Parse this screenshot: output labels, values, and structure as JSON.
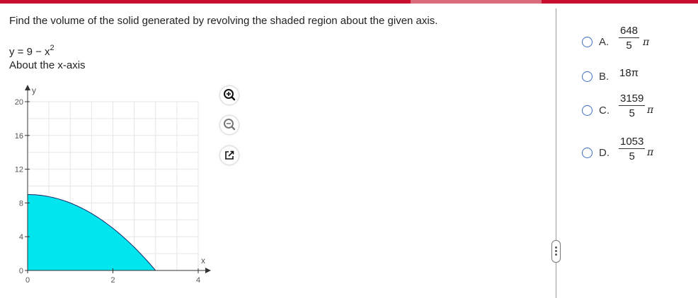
{
  "header": {
    "accent": "#c8102e"
  },
  "question": {
    "prompt": "Find the volume of the solid generated by revolving the shaded region about the given axis.",
    "equation_base": "y = 9 − x",
    "equation_exp": "2",
    "axis": "About the x-axis"
  },
  "graph": {
    "x_label": "x",
    "y_label": "y",
    "x_ticks": [
      "0",
      "2",
      "4"
    ],
    "y_ticks": [
      "0",
      "4",
      "8",
      "12",
      "16",
      "20"
    ],
    "fill_color": "#00e5ee"
  },
  "tools": {
    "zoom_in": "zoom-in-icon",
    "zoom_out": "zoom-out-icon",
    "popout": "external-link-icon"
  },
  "choices": [
    {
      "letter": "A.",
      "numerator": "648",
      "denominator": "5",
      "pi": "π"
    },
    {
      "letter": "B.",
      "value": "18π"
    },
    {
      "letter": "C.",
      "numerator": "3159",
      "denominator": "5",
      "pi": "π"
    },
    {
      "letter": "D.",
      "numerator": "1053",
      "denominator": "5",
      "pi": "π"
    }
  ],
  "chart_data": {
    "type": "area",
    "x": [
      0,
      0.5,
      1,
      1.5,
      2,
      2.5,
      3
    ],
    "values": [
      9,
      8.75,
      8,
      6.75,
      5,
      2.75,
      0
    ],
    "xlim": [
      0,
      4
    ],
    "ylim": [
      0,
      20
    ],
    "xlabel": "x",
    "ylabel": "y"
  }
}
